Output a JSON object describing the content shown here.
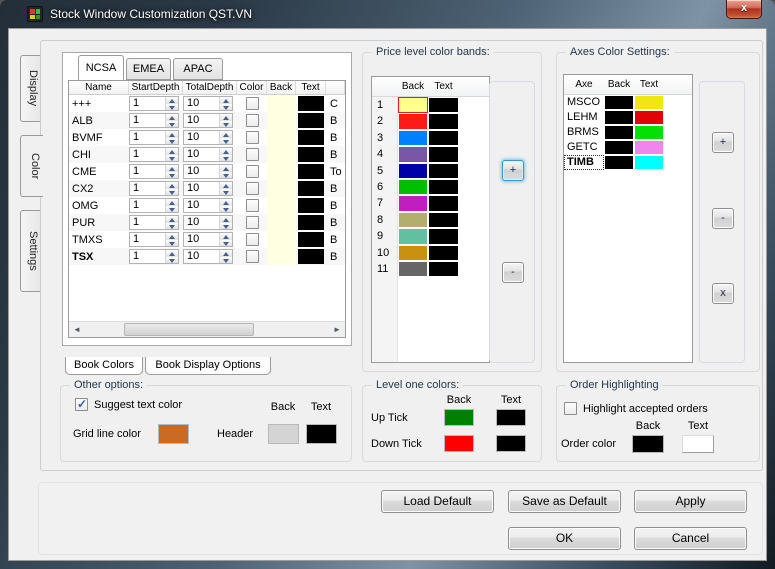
{
  "window": {
    "title": "Stock Window Customization QST.VN",
    "close_label": "x"
  },
  "side_tabs": [
    {
      "label": "Display",
      "active": false
    },
    {
      "label": "Color",
      "active": true
    },
    {
      "label": "Settings",
      "active": false
    }
  ],
  "region_tabs": [
    {
      "label": "NCSA",
      "active": true
    },
    {
      "label": "EMEA",
      "active": false
    },
    {
      "label": "APAC",
      "active": false
    }
  ],
  "book_table": {
    "columns": [
      "Name",
      "StartDepth",
      "TotalDepth",
      "Color",
      "Back",
      "Text"
    ],
    "back_color": "#FFFFE1",
    "text_color": "#000000",
    "rows": [
      {
        "name": "+++",
        "start": "1",
        "total": "10",
        "color_checked": false,
        "extra": "C",
        "bold": false
      },
      {
        "name": "ALB",
        "start": "1",
        "total": "10",
        "color_checked": false,
        "extra": "B",
        "bold": false
      },
      {
        "name": "BVMF",
        "start": "1",
        "total": "10",
        "color_checked": false,
        "extra": "B",
        "bold": false
      },
      {
        "name": "CHI",
        "start": "1",
        "total": "10",
        "color_checked": false,
        "extra": "B",
        "bold": false
      },
      {
        "name": "CME",
        "start": "1",
        "total": "10",
        "color_checked": false,
        "extra": "To",
        "bold": false
      },
      {
        "name": "CX2",
        "start": "1",
        "total": "10",
        "color_checked": false,
        "extra": "B",
        "bold": false
      },
      {
        "name": "OMG",
        "start": "1",
        "total": "10",
        "color_checked": false,
        "extra": "B",
        "bold": false
      },
      {
        "name": "PUR",
        "start": "1",
        "total": "10",
        "color_checked": false,
        "extra": "B",
        "bold": false
      },
      {
        "name": "TMXS",
        "start": "1",
        "total": "10",
        "color_checked": false,
        "extra": "B",
        "bold": false
      },
      {
        "name": "TSX",
        "start": "1",
        "total": "10",
        "color_checked": false,
        "extra": "B",
        "bold": true
      }
    ]
  },
  "book_tabs": [
    {
      "label": "Book Colors",
      "active": true
    },
    {
      "label": "Book Display Options",
      "active": false
    }
  ],
  "price_bands": {
    "title": "Price level color bands:",
    "columns": [
      "Back",
      "Text"
    ],
    "rows": [
      {
        "n": "1",
        "back": "#FFFF8C",
        "text": "#000000",
        "selected": true
      },
      {
        "n": "2",
        "back": "#FF1A1A",
        "text": "#000000",
        "selected": false
      },
      {
        "n": "3",
        "back": "#0080FF",
        "text": "#000000",
        "selected": false
      },
      {
        "n": "4",
        "back": "#7B55A8",
        "text": "#000000",
        "selected": false
      },
      {
        "n": "5",
        "back": "#0000A8",
        "text": "#000000",
        "selected": false
      },
      {
        "n": "6",
        "back": "#00BE00",
        "text": "#000000",
        "selected": false
      },
      {
        "n": "7",
        "back": "#C01FC0",
        "text": "#000000",
        "selected": false
      },
      {
        "n": "8",
        "back": "#B2AE6E",
        "text": "#000000",
        "selected": false
      },
      {
        "n": "9",
        "back": "#62BFA2",
        "text": "#000000",
        "selected": false
      },
      {
        "n": "10",
        "back": "#C89210",
        "text": "#000000",
        "selected": false
      },
      {
        "n": "11",
        "back": "#666666",
        "text": "#000000",
        "selected": false
      }
    ],
    "add_label": "+",
    "remove_label": "-"
  },
  "axes": {
    "title": "Axes Color Settings:",
    "columns": [
      "Axe",
      "Back",
      "Text"
    ],
    "rows": [
      {
        "axe": "MSCO",
        "back": "#000000",
        "text": "#F0E614",
        "focused": false
      },
      {
        "axe": "LEHM",
        "back": "#000000",
        "text": "#E00404",
        "focused": false
      },
      {
        "axe": "BRMS",
        "back": "#000000",
        "text": "#04E004",
        "focused": false
      },
      {
        "axe": "GETC",
        "back": "#000000",
        "text": "#EE86EE",
        "focused": false
      },
      {
        "axe": "TIMB",
        "back": "#000000",
        "text": "#00FFFF",
        "focused": true
      }
    ],
    "add_label": "+",
    "remove_label": "-",
    "delete_label": "x"
  },
  "other_options": {
    "title": "Other options:",
    "suggest_label": "Suggest  text color",
    "suggest_checked": true,
    "back_label": "Back",
    "text_label": "Text",
    "grid_label": "Grid line color",
    "grid_color": "#C96B25",
    "header_label": "Header",
    "header_back": "#D4D4D4",
    "header_text": "#000000"
  },
  "level_one": {
    "title": "Level one colors:",
    "back_label": "Back",
    "text_label": "Text",
    "rows": [
      {
        "label": "Up Tick",
        "back": "#008000",
        "text": "#000000"
      },
      {
        "label": "Down Tick",
        "back": "#FF0000",
        "text": "#000000"
      }
    ]
  },
  "order_highlighting": {
    "title": "Order Highlighting",
    "checkbox_label": "Highlight accepted orders",
    "checked": false,
    "back_label": "Back",
    "text_label": "Text",
    "order_label": "Order color",
    "back": "#000000",
    "text": "#FFFFFF"
  },
  "footer_buttons": {
    "load": "Load Default",
    "save": "Save as Default",
    "apply": "Apply",
    "ok": "OK",
    "cancel": "Cancel"
  }
}
